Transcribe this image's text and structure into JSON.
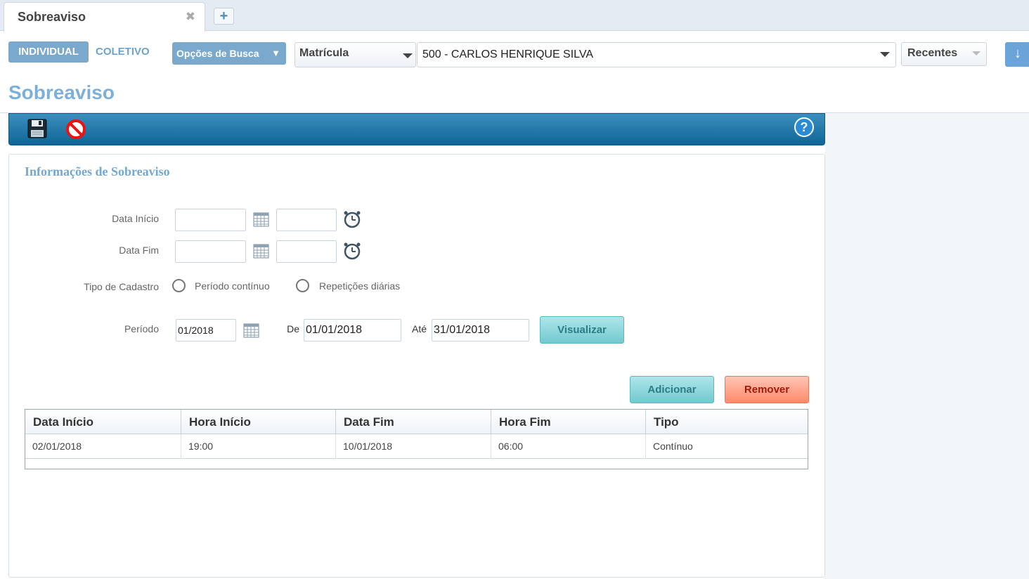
{
  "tabs": {
    "active_title": "Sobreaviso",
    "close_glyph": "✖",
    "add_glyph": "+"
  },
  "search": {
    "individual_label": "INDIVIDUAL",
    "coletivo_label": "COLETIVO",
    "options_label": "Opções de Busca",
    "options_arrow": "▼",
    "field_selected": "Matrícula",
    "employee_selected": "500 - CARLOS HENRIQUE SILVA",
    "recent_label": "Recentes",
    "download_glyph": "↓"
  },
  "page": {
    "title": "Sobreaviso"
  },
  "toolbar": {
    "icons": [
      "save-icon",
      "cancel-icon",
      "help-icon"
    ],
    "help_glyph": "?"
  },
  "form": {
    "section_title": "Informações de Sobreaviso",
    "data_inicio_label": "Data Início",
    "data_fim_label": "Data Fim",
    "data_inicio_value": "",
    "hora_inicio_value": "",
    "data_fim_value": "",
    "hora_fim_value": "",
    "tipo_cadastro_label": "Tipo de Cadastro",
    "radio_continuo_label": "Período contínuo",
    "radio_repeticoes_label": "Repetições diárias",
    "periodo_label": "Período",
    "periodo_value": "01/2018",
    "de_label": "De",
    "de_value": "01/01/2018",
    "ate_label": "Até",
    "ate_value": "31/01/2018",
    "visualizar_label": "Visualizar",
    "adicionar_label": "Adicionar",
    "remover_label": "Remover"
  },
  "grid": {
    "columns": [
      "Data Início",
      "Hora Início",
      "Data Fim",
      "Hora Fim",
      "Tipo"
    ],
    "rows": [
      [
        "02/01/2018",
        "19:00",
        "10/01/2018",
        "06:00",
        "Contínuo"
      ]
    ]
  },
  "colors": {
    "accent": "#7aa9cd",
    "toolbar": "#1a72a3",
    "title": "#7cb0d9",
    "add_button": "#72c9cf",
    "remove_button": "#ff8a6a"
  }
}
